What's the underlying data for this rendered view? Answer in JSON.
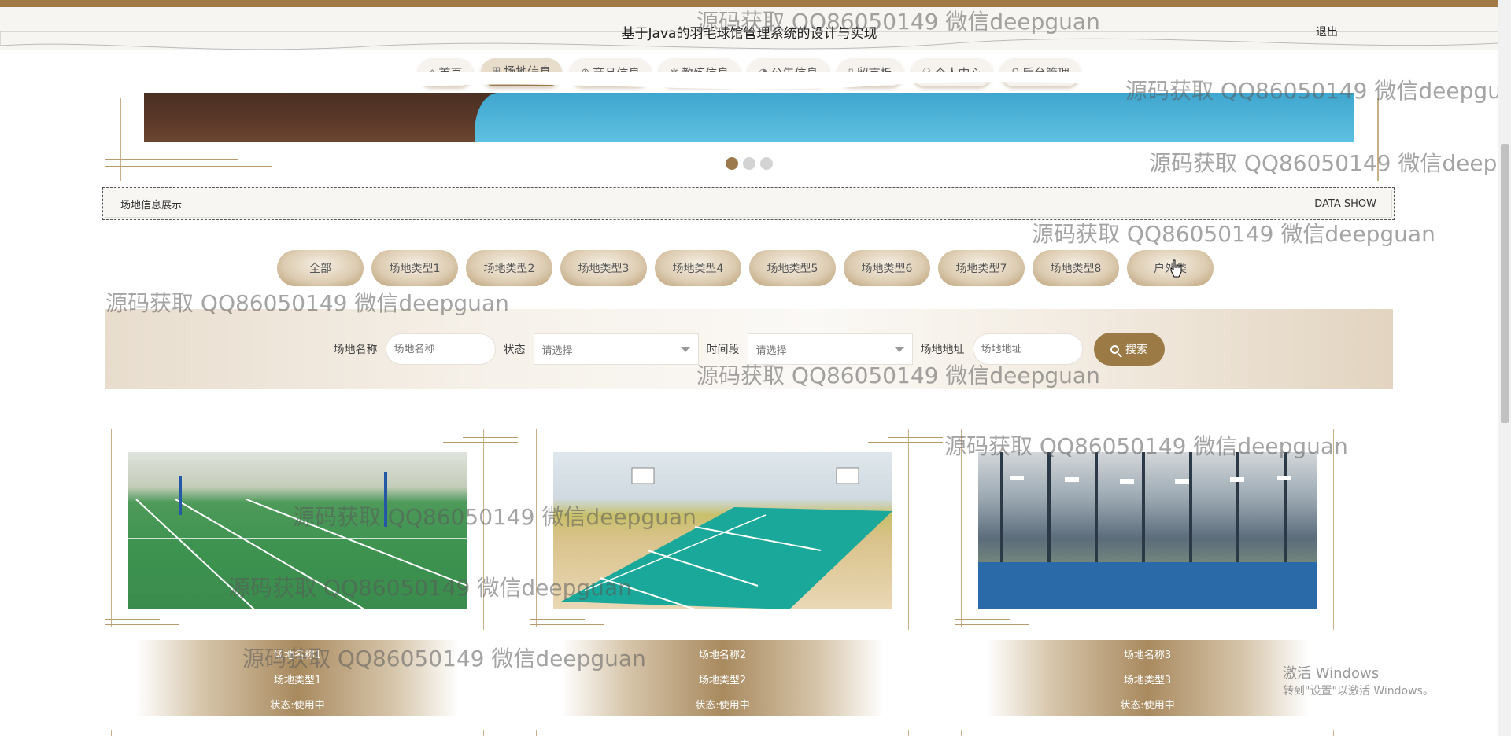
{
  "header": {
    "title": "基于Java的羽毛球馆管理系统的设计与实现",
    "logout": "退出"
  },
  "nav": {
    "items": [
      {
        "label": "首页",
        "icon": "⌂"
      },
      {
        "label": "场地信息",
        "icon": "⊞"
      },
      {
        "label": "商品信息",
        "icon": "⊕"
      },
      {
        "label": "教练信息",
        "icon": "✲"
      },
      {
        "label": "公告信息",
        "icon": "◔"
      },
      {
        "label": "留言板",
        "icon": "▯"
      },
      {
        "label": "个人中心",
        "icon": "⚇"
      },
      {
        "label": "后台管理",
        "icon": "⚲"
      }
    ],
    "active_index": 1
  },
  "carousel": {
    "dot_count": 3,
    "active_index": 0
  },
  "section": {
    "title": "场地信息展示",
    "subtitle": "DATA SHOW"
  },
  "categories": [
    "全部",
    "场地类型1",
    "场地类型2",
    "场地类型3",
    "场地类型4",
    "场地类型5",
    "场地类型6",
    "场地类型7",
    "场地类型8",
    "户外类"
  ],
  "search": {
    "name_label": "场地名称",
    "name_placeholder": "场地名称",
    "status_label": "状态",
    "status_value": "请选择",
    "time_label": "时间段",
    "time_value": "请选择",
    "address_label": "场地地址",
    "address_placeholder": "场地地址",
    "button_label": "搜索"
  },
  "venues": [
    {
      "name": "场地名称1",
      "type": "场地类型1",
      "status": "状态:使用中"
    },
    {
      "name": "场地名称2",
      "type": "场地类型2",
      "status": "状态:使用中"
    },
    {
      "name": "场地名称3",
      "type": "场地类型3",
      "status": "状态:使用中"
    }
  ],
  "watermark": "源码获取 QQ86050149 微信deepguan",
  "windows_activation": {
    "title": "激活 Windows",
    "subtitle": "转到\"设置\"以激活 Windows。"
  },
  "colors": {
    "accent": "#9c7a45",
    "top_strip": "#a27a45"
  }
}
